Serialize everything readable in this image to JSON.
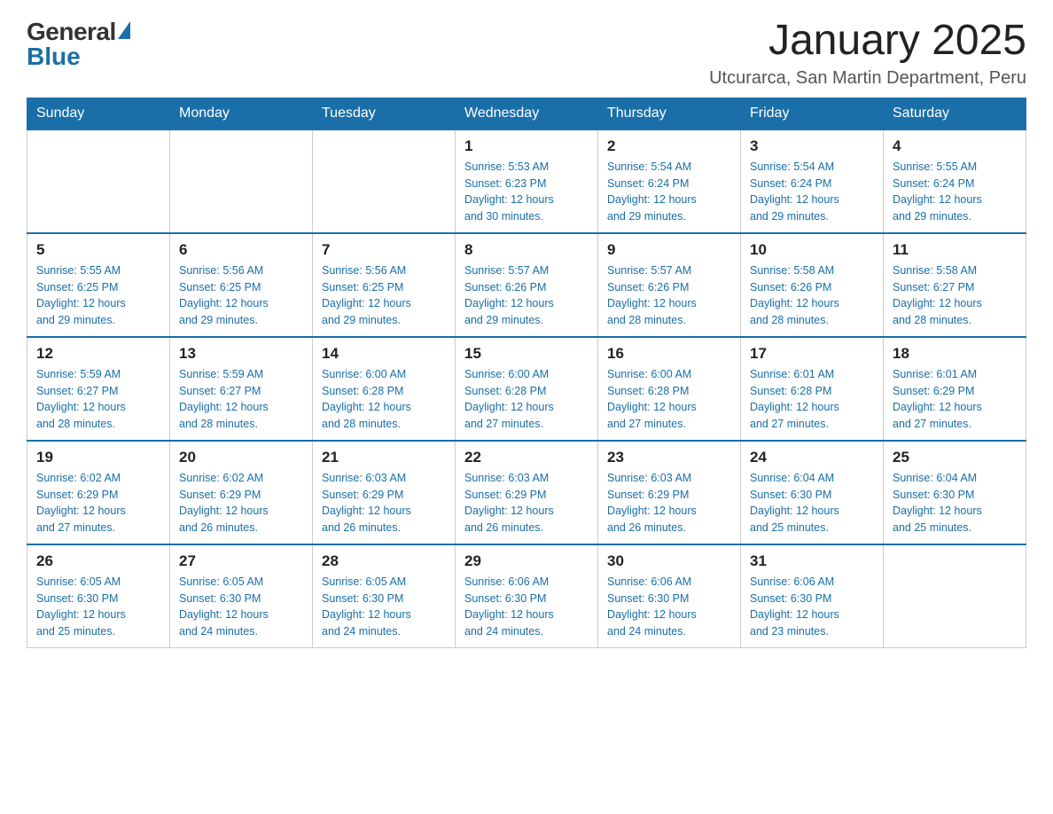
{
  "logo": {
    "general": "General",
    "blue": "Blue"
  },
  "header": {
    "title": "January 2025",
    "subtitle": "Utcurarca, San Martin Department, Peru"
  },
  "days_of_week": [
    "Sunday",
    "Monday",
    "Tuesday",
    "Wednesday",
    "Thursday",
    "Friday",
    "Saturday"
  ],
  "weeks": [
    [
      {
        "day": "",
        "info": ""
      },
      {
        "day": "",
        "info": ""
      },
      {
        "day": "",
        "info": ""
      },
      {
        "day": "1",
        "info": "Sunrise: 5:53 AM\nSunset: 6:23 PM\nDaylight: 12 hours\nand 30 minutes."
      },
      {
        "day": "2",
        "info": "Sunrise: 5:54 AM\nSunset: 6:24 PM\nDaylight: 12 hours\nand 29 minutes."
      },
      {
        "day": "3",
        "info": "Sunrise: 5:54 AM\nSunset: 6:24 PM\nDaylight: 12 hours\nand 29 minutes."
      },
      {
        "day": "4",
        "info": "Sunrise: 5:55 AM\nSunset: 6:24 PM\nDaylight: 12 hours\nand 29 minutes."
      }
    ],
    [
      {
        "day": "5",
        "info": "Sunrise: 5:55 AM\nSunset: 6:25 PM\nDaylight: 12 hours\nand 29 minutes."
      },
      {
        "day": "6",
        "info": "Sunrise: 5:56 AM\nSunset: 6:25 PM\nDaylight: 12 hours\nand 29 minutes."
      },
      {
        "day": "7",
        "info": "Sunrise: 5:56 AM\nSunset: 6:25 PM\nDaylight: 12 hours\nand 29 minutes."
      },
      {
        "day": "8",
        "info": "Sunrise: 5:57 AM\nSunset: 6:26 PM\nDaylight: 12 hours\nand 29 minutes."
      },
      {
        "day": "9",
        "info": "Sunrise: 5:57 AM\nSunset: 6:26 PM\nDaylight: 12 hours\nand 28 minutes."
      },
      {
        "day": "10",
        "info": "Sunrise: 5:58 AM\nSunset: 6:26 PM\nDaylight: 12 hours\nand 28 minutes."
      },
      {
        "day": "11",
        "info": "Sunrise: 5:58 AM\nSunset: 6:27 PM\nDaylight: 12 hours\nand 28 minutes."
      }
    ],
    [
      {
        "day": "12",
        "info": "Sunrise: 5:59 AM\nSunset: 6:27 PM\nDaylight: 12 hours\nand 28 minutes."
      },
      {
        "day": "13",
        "info": "Sunrise: 5:59 AM\nSunset: 6:27 PM\nDaylight: 12 hours\nand 28 minutes."
      },
      {
        "day": "14",
        "info": "Sunrise: 6:00 AM\nSunset: 6:28 PM\nDaylight: 12 hours\nand 28 minutes."
      },
      {
        "day": "15",
        "info": "Sunrise: 6:00 AM\nSunset: 6:28 PM\nDaylight: 12 hours\nand 27 minutes."
      },
      {
        "day": "16",
        "info": "Sunrise: 6:00 AM\nSunset: 6:28 PM\nDaylight: 12 hours\nand 27 minutes."
      },
      {
        "day": "17",
        "info": "Sunrise: 6:01 AM\nSunset: 6:28 PM\nDaylight: 12 hours\nand 27 minutes."
      },
      {
        "day": "18",
        "info": "Sunrise: 6:01 AM\nSunset: 6:29 PM\nDaylight: 12 hours\nand 27 minutes."
      }
    ],
    [
      {
        "day": "19",
        "info": "Sunrise: 6:02 AM\nSunset: 6:29 PM\nDaylight: 12 hours\nand 27 minutes."
      },
      {
        "day": "20",
        "info": "Sunrise: 6:02 AM\nSunset: 6:29 PM\nDaylight: 12 hours\nand 26 minutes."
      },
      {
        "day": "21",
        "info": "Sunrise: 6:03 AM\nSunset: 6:29 PM\nDaylight: 12 hours\nand 26 minutes."
      },
      {
        "day": "22",
        "info": "Sunrise: 6:03 AM\nSunset: 6:29 PM\nDaylight: 12 hours\nand 26 minutes."
      },
      {
        "day": "23",
        "info": "Sunrise: 6:03 AM\nSunset: 6:29 PM\nDaylight: 12 hours\nand 26 minutes."
      },
      {
        "day": "24",
        "info": "Sunrise: 6:04 AM\nSunset: 6:30 PM\nDaylight: 12 hours\nand 25 minutes."
      },
      {
        "day": "25",
        "info": "Sunrise: 6:04 AM\nSunset: 6:30 PM\nDaylight: 12 hours\nand 25 minutes."
      }
    ],
    [
      {
        "day": "26",
        "info": "Sunrise: 6:05 AM\nSunset: 6:30 PM\nDaylight: 12 hours\nand 25 minutes."
      },
      {
        "day": "27",
        "info": "Sunrise: 6:05 AM\nSunset: 6:30 PM\nDaylight: 12 hours\nand 24 minutes."
      },
      {
        "day": "28",
        "info": "Sunrise: 6:05 AM\nSunset: 6:30 PM\nDaylight: 12 hours\nand 24 minutes."
      },
      {
        "day": "29",
        "info": "Sunrise: 6:06 AM\nSunset: 6:30 PM\nDaylight: 12 hours\nand 24 minutes."
      },
      {
        "day": "30",
        "info": "Sunrise: 6:06 AM\nSunset: 6:30 PM\nDaylight: 12 hours\nand 24 minutes."
      },
      {
        "day": "31",
        "info": "Sunrise: 6:06 AM\nSunset: 6:30 PM\nDaylight: 12 hours\nand 23 minutes."
      },
      {
        "day": "",
        "info": ""
      }
    ]
  ]
}
